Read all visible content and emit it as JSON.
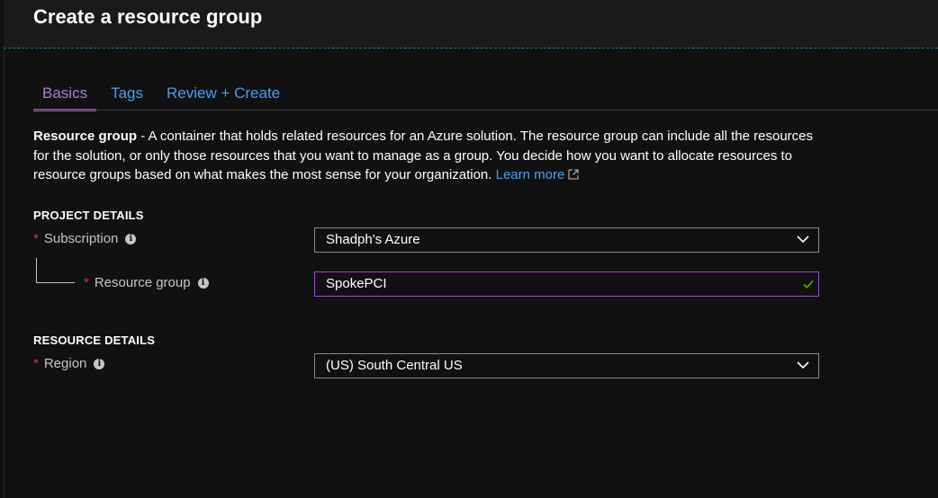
{
  "page": {
    "title": "Create a resource group"
  },
  "tabs": [
    {
      "label": "Basics",
      "active": true
    },
    {
      "label": "Tags",
      "active": false
    },
    {
      "label": "Review + Create",
      "active": false
    }
  ],
  "description": {
    "term": "Resource group",
    "text": " - A container that holds related resources for an Azure solution. The resource group can include all the resources for the solution, or only those resources that you want to manage as a group. You decide how you want to allocate resources to resource groups based on what makes the most sense for your organization. ",
    "learn_more": "Learn more"
  },
  "project_details": {
    "heading": "PROJECT DETAILS",
    "subscription": {
      "label": "Subscription",
      "value": "Shadph's Azure"
    },
    "resource_group": {
      "label": "Resource group",
      "value": "SpokePCI"
    }
  },
  "resource_details": {
    "heading": "RESOURCE DETAILS",
    "region": {
      "label": "Region",
      "value": "(US) South Central US"
    }
  },
  "required_marker": "*",
  "info_glyph": "i",
  "colors": {
    "accent_purple": "#9b4fc7",
    "link_blue": "#4a9ef2",
    "required_red": "#e0343a",
    "valid_green": "#57a300",
    "background": "#111111"
  },
  "icons": [
    "info-icon",
    "chevron-down-icon",
    "checkmark-icon",
    "external-link-icon"
  ]
}
